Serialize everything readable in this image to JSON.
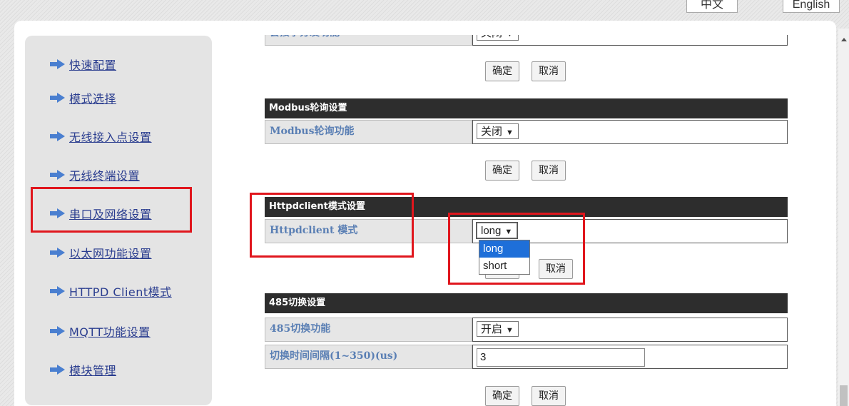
{
  "lang": {
    "zh": "中文",
    "en": "English"
  },
  "sidebar": {
    "items": [
      {
        "label": "快速配置"
      },
      {
        "label": "模式选择"
      },
      {
        "label": "无线接入点设置"
      },
      {
        "label": "无线终端设置"
      },
      {
        "label": "串口及网络设置"
      },
      {
        "label": "以太网功能设置"
      },
      {
        "label": "HTTPD Client模式"
      },
      {
        "label": "MQTT功能设置"
      },
      {
        "label": "模块管理"
      }
    ]
  },
  "sections": {
    "top_partial": {
      "label": "套接字分发功能",
      "select_value": "关闭"
    },
    "modbus": {
      "title": "Modbus轮询设置",
      "label": "Modbus轮询功能",
      "select_value": "关闭"
    },
    "httpd": {
      "title": "Httpdclient模式设置",
      "label": "Httpdclient 模式",
      "select_value": "long",
      "options": [
        "long",
        "short"
      ]
    },
    "rs485": {
      "title": "485切换设置",
      "label_switch": "485切换功能",
      "select_value": "开启",
      "label_interval": "切换时间间隔(1~350)(us)",
      "interval_value": "3"
    }
  },
  "buttons": {
    "ok": "确定",
    "cancel": "取消"
  },
  "colors": {
    "highlight": "#e0161d",
    "header_bg": "#2d2d2d",
    "link": "#2a3d8f",
    "label_text": "#5a7fb4",
    "arrow": "#4a7fd0"
  }
}
